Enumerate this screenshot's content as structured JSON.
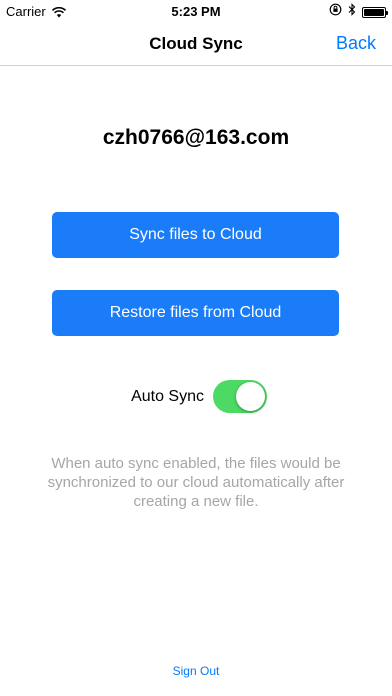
{
  "status_bar": {
    "carrier": "Carrier",
    "time": "5:23 PM",
    "icons": [
      "wifi-icon",
      "rotation-lock-icon",
      "bluetooth-icon",
      "battery-icon"
    ]
  },
  "nav": {
    "title": "Cloud Sync",
    "back_label": "Back"
  },
  "account": {
    "email": "czh0766@163.com"
  },
  "actions": {
    "sync_label": "Sync files to Cloud",
    "restore_label": "Restore files from Cloud"
  },
  "auto_sync": {
    "label": "Auto Sync",
    "enabled": true
  },
  "hint": "When auto sync enabled, the files would be synchronized to our cloud automatically after creating a new file.",
  "footer": {
    "sign_out_label": "Sign Out"
  },
  "colors": {
    "accent": "#007aff",
    "button_bg": "#1a7cf9",
    "switch_on": "#4cd964",
    "hint_text": "#a6a6a6"
  }
}
